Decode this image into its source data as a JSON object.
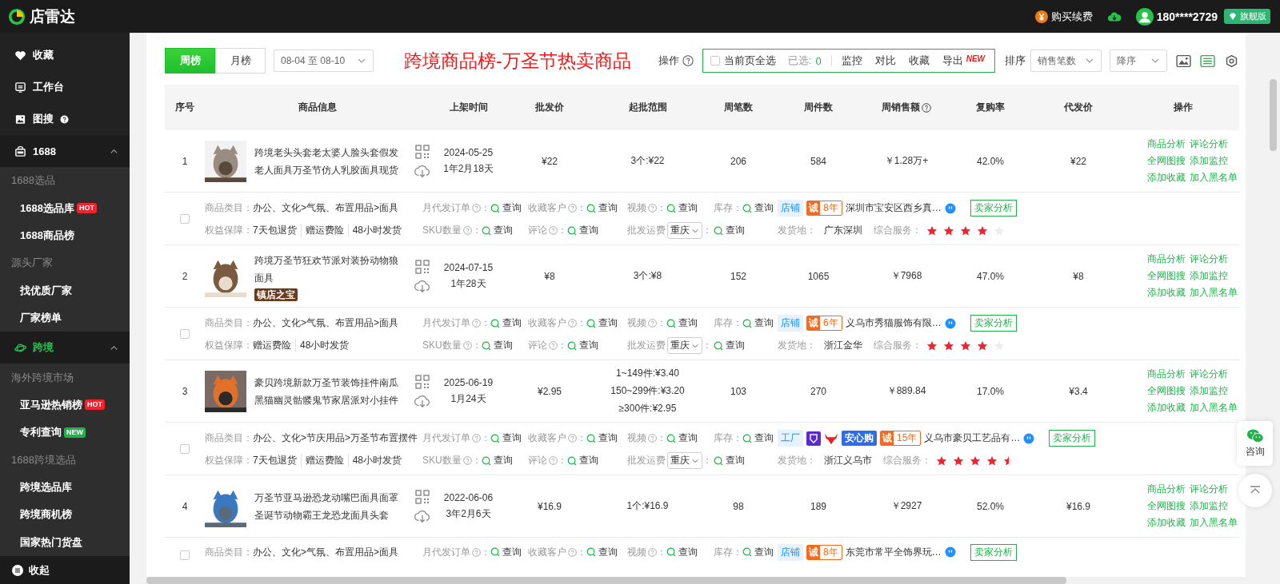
{
  "header": {
    "brand": "店雷达",
    "buy_renew": "购买续费",
    "phone": "180****2729",
    "plan": "旗舰版"
  },
  "sidebar": {
    "items": [
      {
        "kind": "link",
        "label": "收藏"
      },
      {
        "kind": "link",
        "label": "工作台"
      },
      {
        "kind": "link",
        "label": "图搜",
        "help": true
      },
      {
        "kind": "group",
        "label": "1688",
        "expanded": true,
        "selected": false
      },
      {
        "kind": "section",
        "label": "1688选品"
      },
      {
        "kind": "sub",
        "label": "1688选品库",
        "badge": {
          "text": "HOT",
          "color": "#f5222d"
        }
      },
      {
        "kind": "sub",
        "label": "1688商品榜"
      },
      {
        "kind": "section",
        "label": "源头厂家"
      },
      {
        "kind": "sub",
        "label": "找优质厂家"
      },
      {
        "kind": "sub",
        "label": "厂家榜单"
      },
      {
        "kind": "group",
        "label": "跨境",
        "expanded": true,
        "selected": true
      },
      {
        "kind": "section",
        "label": "海外跨境市场"
      },
      {
        "kind": "sub",
        "label": "亚马逊热销榜",
        "badge": {
          "text": "HOT",
          "color": "#f5222d"
        }
      },
      {
        "kind": "sub",
        "label": "专利查询",
        "badge": {
          "text": "NEW",
          "color": "#21b24b"
        }
      },
      {
        "kind": "section",
        "label": "1688跨境选品"
      },
      {
        "kind": "sub",
        "label": "跨境选品库"
      },
      {
        "kind": "sub",
        "label": "跨境商机榜"
      },
      {
        "kind": "sub",
        "label": "国家热门货盘"
      }
    ],
    "collapse": "收起"
  },
  "toolbar": {
    "periods": [
      {
        "label": "周榜",
        "selected": true
      },
      {
        "label": "月榜",
        "selected": false
      }
    ],
    "date_range": "08-04 至 08-10",
    "page_title": "跨境商品榜-万圣节热卖商品",
    "operate_label": "操作",
    "select_all": {
      "label": "当前页全选",
      "checked": false
    },
    "selected_label": "已选:",
    "selected_count": "0",
    "actions": [
      "监控",
      "对比",
      "收藏",
      "导出"
    ],
    "export_badge": "NEW",
    "sort_label": "排序",
    "sort_field": "销售笔数",
    "sort_order": "降序",
    "views": [
      {
        "selected": false
      },
      {
        "selected": true
      }
    ]
  },
  "table": {
    "columns": [
      {
        "label": "序号"
      },
      {
        "label": "商品信息"
      },
      {
        "label": "上架时间"
      },
      {
        "label": "批发价"
      },
      {
        "label": "起批范围"
      },
      {
        "label": "周笔数"
      },
      {
        "label": "周件数"
      },
      {
        "label": "周销售额",
        "help": true
      },
      {
        "label": "复购率"
      },
      {
        "label": "代发价"
      },
      {
        "label": "操作"
      }
    ],
    "rows": [
      {
        "rank": "1",
        "title": "跨境老头头套老太婆人脸头套假发老人面具万圣节仿人乳胶面具现货",
        "listed_date": "2024-05-25",
        "listed_age": "1年2月18天",
        "wholesale_price": "¥22",
        "batch_range": [
          "3个:¥22"
        ],
        "weekly_orders": "206",
        "weekly_units": "584",
        "weekly_sales": "￥1.28万+",
        "repurchase_rate": "42.0%",
        "dropship_price": "¥22",
        "actions": [
          "商品分析",
          "评论分析",
          "全网图搜",
          "添加监控",
          "添加收藏",
          "加入黑名单"
        ],
        "detail": {
          "checked": false,
          "category_label": "商品类目：",
          "category": "办公、文化>气氛、布置用品>面具",
          "guarantee_label": "权益保障：",
          "guarantees": [
            "7天包退货",
            "赠运费险",
            "48小时发货"
          ],
          "queries": [
            {
              "label": "月代发订单",
              "help": true,
              "sep": "：",
              "value": "查询"
            },
            {
              "label": "收藏客户",
              "help": true,
              "sep": "：",
              "value": "查询"
            },
            {
              "label": "视频",
              "help": true,
              "sep": "：",
              "value": "查询"
            },
            {
              "label": "库存",
              "help": false,
              "sep": "：",
              "value": "查询"
            },
            {
              "label": "SKU数量",
              "help": true,
              "sep": "：",
              "value": "查询"
            },
            {
              "label": "评论",
              "help": true,
              "sep": "：",
              "value": "查询"
            }
          ],
          "shipping": {
            "label": "批发运费",
            "city": "重庆",
            "sep": "：",
            "value": "查询"
          },
          "shop": {
            "type": "店铺",
            "premium_icons": false,
            "seal": "诚",
            "years": "8年",
            "name": "深圳市宝安区西乡真…",
            "analysis": "卖家分析"
          },
          "origin_label": "发货地：",
          "origin": "广东深圳",
          "service_label": "综合服务：",
          "stars": 4
        }
      },
      {
        "rank": "2",
        "title": "跨境万圣节狂欢节派对装扮动物狼面具",
        "tag": "镇店之宝",
        "listed_date": "2024-07-15",
        "listed_age": "1年28天",
        "wholesale_price": "¥8",
        "batch_range": [
          "3个:¥8"
        ],
        "weekly_orders": "152",
        "weekly_units": "1065",
        "weekly_sales": "￥7968",
        "repurchase_rate": "47.0%",
        "dropship_price": "¥8",
        "actions": [
          "商品分析",
          "评论分析",
          "全网图搜",
          "添加监控",
          "添加收藏",
          "加入黑名单"
        ],
        "detail": {
          "checked": false,
          "category_label": "商品类目：",
          "category": "办公、文化>气氛、布置用品>面具",
          "guarantee_label": "权益保障：",
          "guarantees": [
            "赠运费险",
            "48小时发货"
          ],
          "queries": [
            {
              "label": "月代发订单",
              "help": true,
              "sep": "：",
              "value": "查询"
            },
            {
              "label": "收藏客户",
              "help": true,
              "sep": "：",
              "value": "查询"
            },
            {
              "label": "视频",
              "help": true,
              "sep": "：",
              "value": "查询"
            },
            {
              "label": "库存",
              "help": false,
              "sep": "：",
              "value": "查询"
            },
            {
              "label": "SKU数量",
              "help": true,
              "sep": "：",
              "value": "查询"
            },
            {
              "label": "评论",
              "help": true,
              "sep": "：",
              "value": "查询"
            }
          ],
          "shipping": {
            "label": "批发运费",
            "city": "重庆",
            "sep": "：",
            "value": "查询"
          },
          "shop": {
            "type": "店铺",
            "premium_icons": false,
            "seal": "诚",
            "years": "6年",
            "name": "义乌市秀猫服饰有限…",
            "analysis": "卖家分析"
          },
          "origin_label": "发货地：",
          "origin": "浙江金华",
          "service_label": "综合服务：",
          "stars": 4
        }
      },
      {
        "rank": "3",
        "title": "豪贝跨境新款万圣节装饰挂件南瓜黑猫幽灵骷髅鬼节家居派对小挂件",
        "listed_date": "2025-06-19",
        "listed_age": "1月24天",
        "wholesale_price": "¥2.95",
        "batch_range": [
          "1~149件:¥3.40",
          "150~299件:¥3.20",
          "≥300件:¥2.95"
        ],
        "weekly_orders": "103",
        "weekly_units": "270",
        "weekly_sales": "￥889.84",
        "repurchase_rate": "17.0%",
        "dropship_price": "¥3.4",
        "actions": [
          "商品分析",
          "评论分析",
          "全网图搜",
          "添加监控",
          "添加收藏",
          "加入黑名单"
        ],
        "detail": {
          "checked": false,
          "category_label": "商品类目：",
          "category": "办公、文化>节庆用品>万圣节布置摆件",
          "guarantee_label": "权益保障：",
          "guarantees": [
            "7天包退货",
            "赠运费险",
            "48小时发货"
          ],
          "queries": [
            {
              "label": "月代发订单",
              "help": true,
              "sep": "：",
              "value": "查询"
            },
            {
              "label": "收藏客户",
              "help": true,
              "sep": "：",
              "value": "查询"
            },
            {
              "label": "视频",
              "help": true,
              "sep": "：",
              "value": "查询"
            },
            {
              "label": "库存",
              "help": false,
              "sep": "：",
              "value": "查询"
            },
            {
              "label": "SKU数量",
              "help": true,
              "sep": "：",
              "value": "查询"
            },
            {
              "label": "评论",
              "help": true,
              "sep": "：",
              "value": "查询"
            }
          ],
          "shipping": {
            "label": "批发运费",
            "city": "重庆",
            "sep": "：",
            "value": "查询"
          },
          "shop": {
            "type": "工厂",
            "premium_icons": true,
            "extra_badge": "安心购",
            "seal": "诚",
            "years": "15年",
            "name": "义乌市豪贝工艺品有…",
            "analysis": "卖家分析"
          },
          "origin_label": "发货地：",
          "origin": "浙江义乌市",
          "service_label": "综合服务：",
          "stars": 4.5
        }
      },
      {
        "rank": "4",
        "title": "万圣节亚马逊恐龙动嘴巴面具面罩圣诞节动物霸王龙恐龙面具头套",
        "listed_date": "2022-06-06",
        "listed_age": "3年2月6天",
        "wholesale_price": "¥16.9",
        "batch_range": [
          "1个:¥16.9"
        ],
        "weekly_orders": "98",
        "weekly_units": "189",
        "weekly_sales": "￥2927",
        "repurchase_rate": "52.0%",
        "dropship_price": "¥16.9",
        "actions": [
          "商品分析",
          "评论分析",
          "全网图搜",
          "添加监控",
          "添加收藏",
          "加入黑名单"
        ],
        "detail": {
          "checked": false,
          "category_label": "商品类目：",
          "category": "办公、文化>气氛、布置用品>面具",
          "queries": [
            {
              "label": "月代发订单",
              "help": true,
              "sep": "：",
              "value": "查询"
            },
            {
              "label": "收藏客户",
              "help": true,
              "sep": "：",
              "value": "查询"
            },
            {
              "label": "视频",
              "help": true,
              "sep": "：",
              "value": "查询"
            },
            {
              "label": "库存",
              "help": false,
              "sep": "：",
              "value": "查询"
            }
          ],
          "shop": {
            "type": "店铺",
            "premium_icons": false,
            "seal": "诚",
            "years": "8年",
            "name": "东莞市常平全饰界玩…",
            "analysis": "卖家分析"
          }
        }
      }
    ]
  },
  "float": {
    "consult": "咨询"
  }
}
